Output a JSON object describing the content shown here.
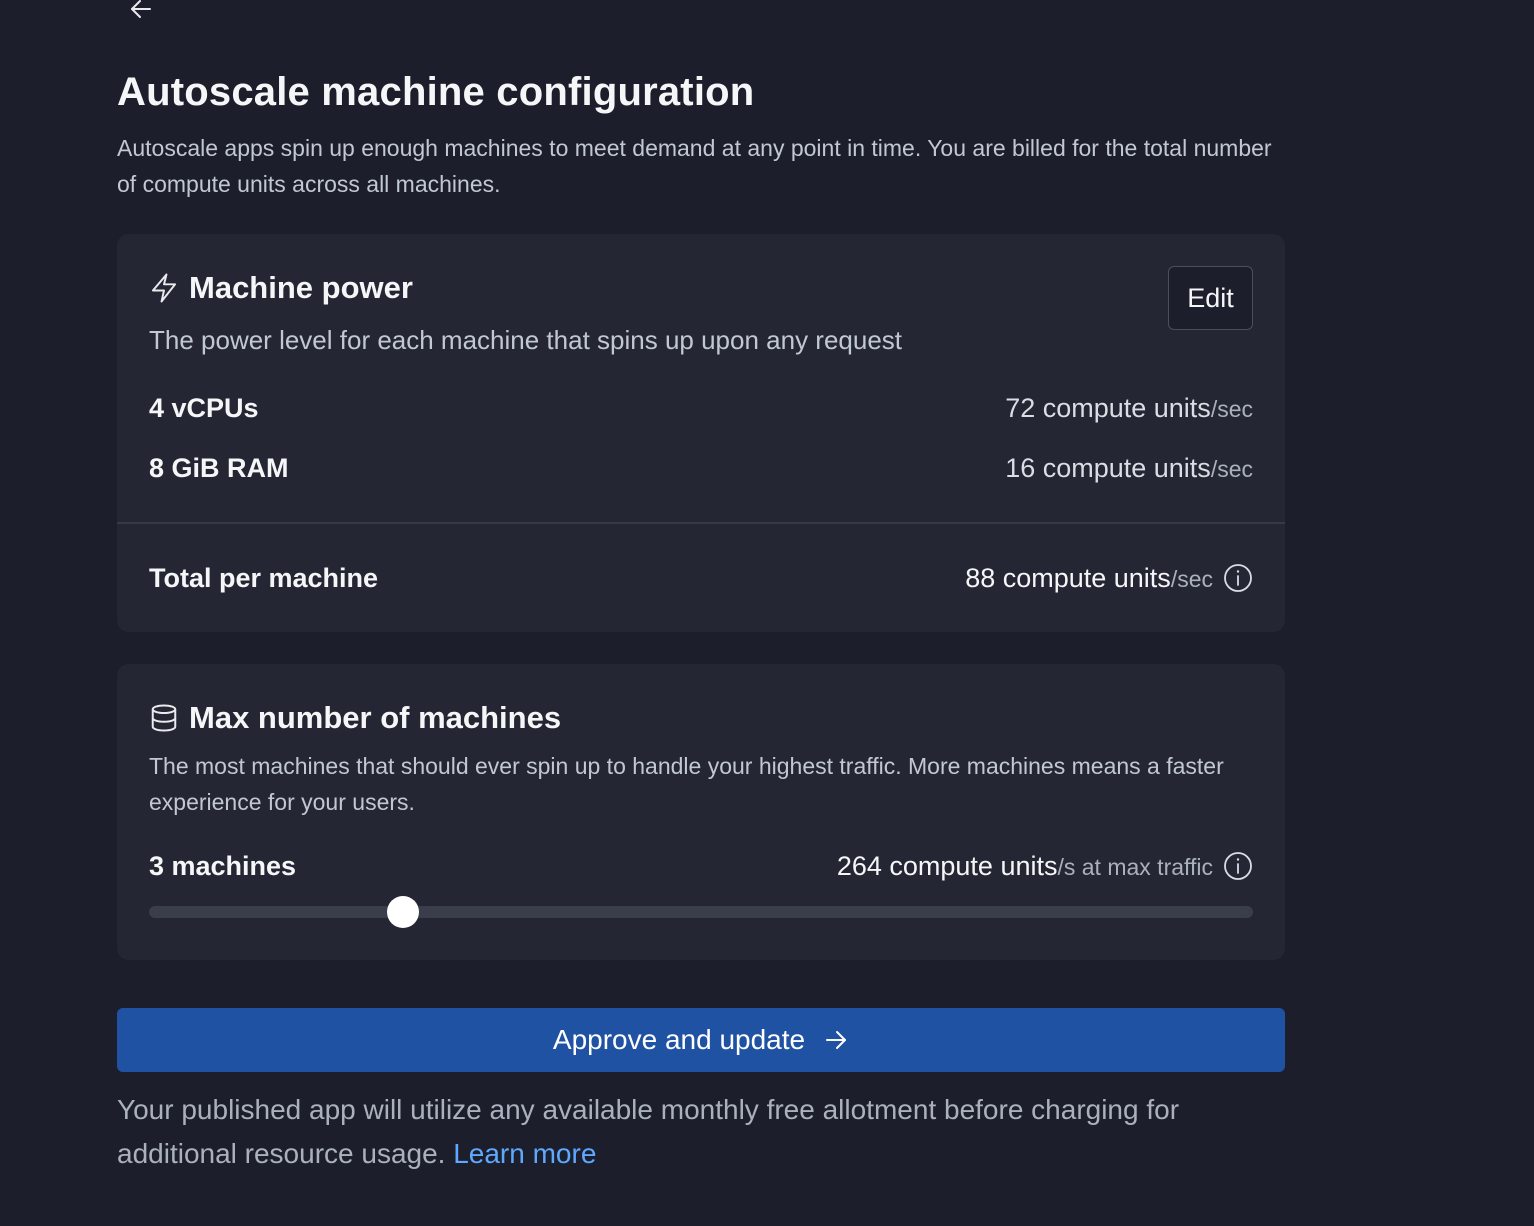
{
  "header": {
    "back_icon": "arrow-left-icon",
    "title": "Autoscale machine configuration",
    "subtitle": "Autoscale apps spin up enough machines to meet demand at any point in time. You are billed for the total number of compute units across all machines."
  },
  "machine_power": {
    "icon": "lightning-bolt-icon",
    "title": "Machine power",
    "description": "The power level for each machine that spins up upon any request",
    "edit_label": "Edit",
    "rows": [
      {
        "label": "4 vCPUs",
        "value": "72 compute units",
        "unit": "/sec"
      },
      {
        "label": "8 GiB RAM",
        "value": "16 compute units",
        "unit": "/sec"
      }
    ],
    "total": {
      "label": "Total per machine",
      "value": "88 compute units",
      "unit": "/sec"
    }
  },
  "max_machines": {
    "icon": "database-icon",
    "title": "Max number of machines",
    "description": "The most machines that should ever spin up to handle your highest traffic. More machines means a faster experience for your users.",
    "count_label": "3 machines",
    "value": "264 compute units",
    "unit": "/s at max traffic",
    "slider": {
      "value": 3,
      "fraction": 0.23
    }
  },
  "approve": {
    "label": "Approve and update",
    "icon": "arrow-right-icon"
  },
  "footer": {
    "text": "Your published app will utilize any available monthly free allotment before charging for additional resource usage. ",
    "link": "Learn more"
  },
  "colors": {
    "background": "#1c1f2b",
    "card": "#242733",
    "primary": "#2052a4",
    "link": "#5fa8ff"
  }
}
